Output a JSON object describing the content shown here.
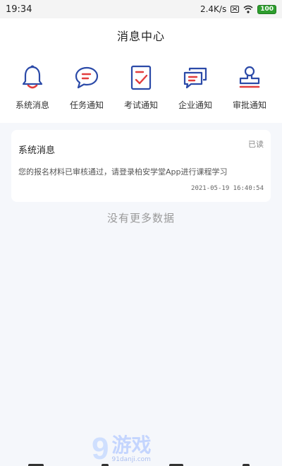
{
  "status_bar": {
    "time": "19:34",
    "speed": "2.4K/s",
    "battery": "100"
  },
  "header": {
    "title": "消息中心"
  },
  "categories": [
    {
      "label": "系统消息",
      "icon": "bell-icon"
    },
    {
      "label": "任务通知",
      "icon": "chat-bubble-icon"
    },
    {
      "label": "考试通知",
      "icon": "exam-checklist-icon"
    },
    {
      "label": "企业通知",
      "icon": "double-chat-icon"
    },
    {
      "label": "审批通知",
      "icon": "stamp-icon"
    }
  ],
  "messages": [
    {
      "title": "系统消息",
      "status": "已读",
      "body": "您的报名材料已审核通过，请登录柏安学堂App进行课程学习",
      "time": "2021-05-19 16:40:54"
    }
  ],
  "list_footer": "没有更多数据",
  "watermark": {
    "number": "9",
    "text": "游戏",
    "url": "91danji.com"
  },
  "colors": {
    "accent_blue": "#2b4aa8",
    "accent_red": "#e23d3d",
    "background": "#f5f7fb"
  }
}
